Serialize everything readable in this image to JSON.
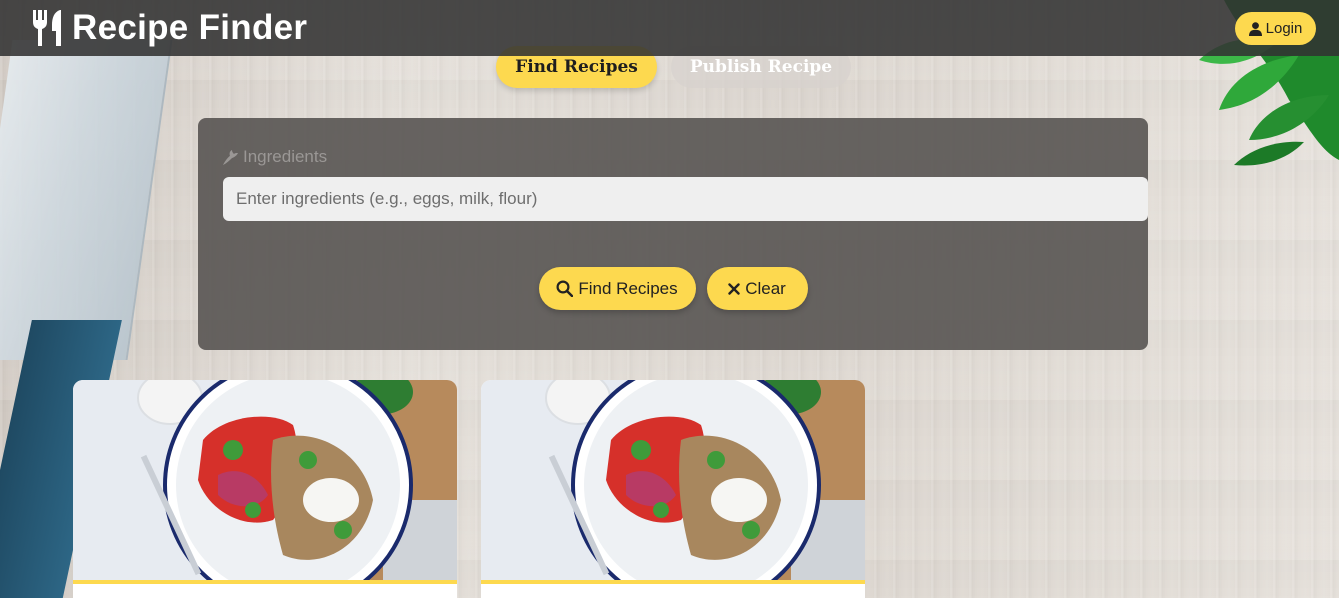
{
  "app": {
    "title": "Recipe Finder",
    "icon": "utensils-icon"
  },
  "header": {
    "login_label": "Login",
    "login_icon": "user-icon"
  },
  "tabs": [
    {
      "label": "Find Recipes",
      "active": true
    },
    {
      "label": "Publish Recipe",
      "active": false
    }
  ],
  "search": {
    "label": "Ingredients",
    "label_icon": "carrot-icon",
    "placeholder": "Enter ingredients (e.g., eggs, milk, flour)",
    "value": "",
    "find_label": "Find Recipes",
    "find_icon": "search-icon",
    "clear_label": "Clear",
    "clear_icon": "close-icon"
  },
  "recipes": [
    {
      "image": "salad-bowl-photo"
    },
    {
      "image": "salad-bowl-photo"
    }
  ],
  "colors": {
    "accent": "#fdd94f",
    "header_bg": "#323232",
    "panel_bg": "#585452"
  }
}
